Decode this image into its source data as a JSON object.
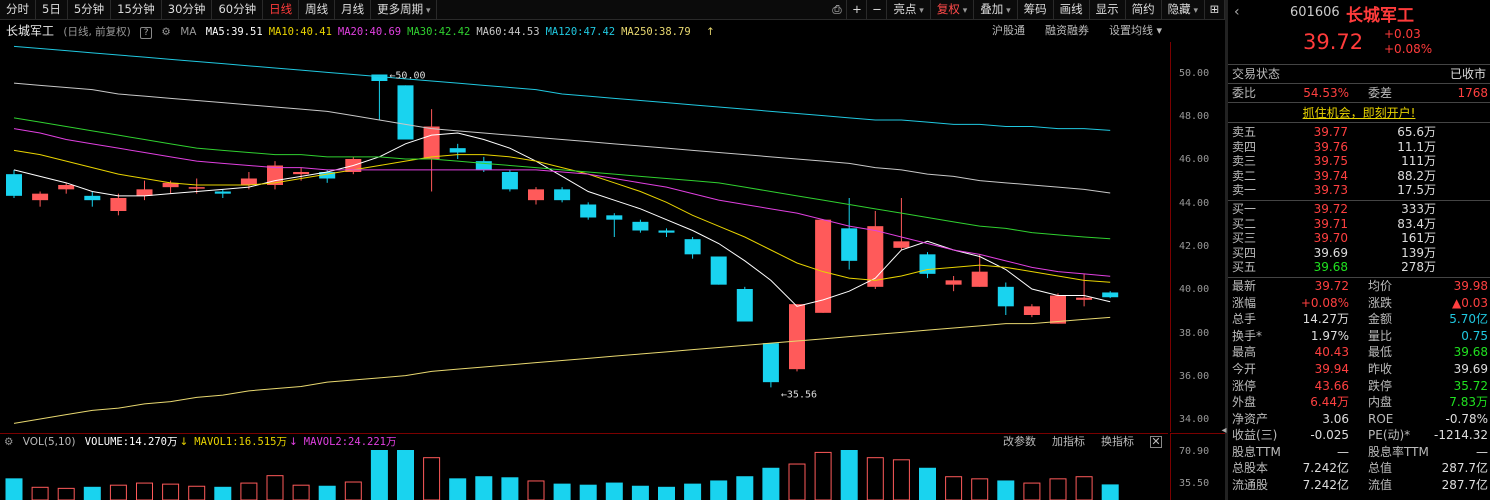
{
  "toolbar": {
    "left": [
      "分时",
      "5日",
      "5分钟",
      "15分钟",
      "30分钟",
      "60分钟",
      "日线",
      "周线",
      "月线",
      "更多周期"
    ],
    "active": "日线",
    "right": [
      "亮点",
      "复权",
      "叠加",
      "筹码",
      "画线",
      "显示",
      "简约",
      "隐藏"
    ]
  },
  "chart_header": {
    "name": "长城军工",
    "mode": "(日线, 前复权)",
    "help": "?",
    "ma_label": "MA",
    "ma": [
      {
        "text": "MA5:39.51",
        "color": "#ffffff"
      },
      {
        "text": "MA10:40.41",
        "color": "#e8d300"
      },
      {
        "text": "MA20:40.69",
        "color": "#e040e0"
      },
      {
        "text": "MA30:42.42",
        "color": "#30d030"
      },
      {
        "text": "MA60:44.53",
        "color": "#c8c8c8"
      },
      {
        "text": "MA120:47.42",
        "color": "#20c8e0"
      },
      {
        "text": "MA250:38.79",
        "color": "#e8d870"
      }
    ],
    "links": [
      "沪股通",
      "融资融券",
      "设置均线"
    ]
  },
  "price_axis": [
    "50.00",
    "48.00",
    "46.00",
    "44.00",
    "42.00",
    "40.00",
    "38.00",
    "36.00",
    "34.00"
  ],
  "annotations": {
    "high": "50.00",
    "low": "35.56"
  },
  "volume_header": {
    "title": "VOL(5,10)",
    "items": [
      {
        "text": "VOLUME:14.270万",
        "color": "#ffffff"
      },
      {
        "text": "MAVOL1:16.515万",
        "color": "#e8d300"
      },
      {
        "text": "MAVOL2:24.221万",
        "color": "#e040e0"
      }
    ],
    "links": [
      "改参数",
      "加指标",
      "换指标"
    ]
  },
  "volume_axis": [
    "70.90",
    "35.50"
  ],
  "panel": {
    "code": "601606",
    "name": "长城军工",
    "price": "39.72",
    "change": "+0.03",
    "change_pct": "+0.08%",
    "status_label": "交易状态",
    "status_value": "已收市",
    "ratio_label": "委比",
    "ratio_value": "54.53%",
    "diff_label": "委差",
    "diff_value": "1768",
    "banner": "抓住机会，即刻开户!",
    "sells": [
      {
        "label": "卖五",
        "price": "39.77",
        "vol": "65.6万"
      },
      {
        "label": "卖四",
        "price": "39.76",
        "vol": "11.1万"
      },
      {
        "label": "卖三",
        "price": "39.75",
        "vol": "111万"
      },
      {
        "label": "卖二",
        "price": "39.74",
        "vol": "88.2万"
      },
      {
        "label": "卖一",
        "price": "39.73",
        "vol": "17.5万"
      }
    ],
    "buys": [
      {
        "label": "买一",
        "price": "39.72",
        "vol": "333万",
        "color": "#ff4040"
      },
      {
        "label": "买二",
        "price": "39.71",
        "vol": "83.4万",
        "color": "#ff4040"
      },
      {
        "label": "买三",
        "price": "39.70",
        "vol": "161万",
        "color": "#ff4040"
      },
      {
        "label": "买四",
        "price": "39.69",
        "vol": "139万",
        "color": "#dddddd"
      },
      {
        "label": "买五",
        "price": "39.68",
        "vol": "278万",
        "color": "#20e020"
      }
    ],
    "quotes": [
      {
        "l1": "最新",
        "v1": "39.72",
        "c1": "#ff4040",
        "l2": "均价",
        "v2": "39.98",
        "c2": "#ff4040"
      },
      {
        "l1": "涨幅",
        "v1": "+0.08%",
        "c1": "#ff4040",
        "l2": "涨跌",
        "v2": "▲0.03",
        "c2": "#ff4040"
      },
      {
        "l1": "总手",
        "v1": "14.27万",
        "c1": "#dddddd",
        "l2": "金额",
        "v2": "5.70亿",
        "c2": "#20c8e0"
      },
      {
        "l1": "换手*",
        "v1": "1.97%",
        "c1": "#dddddd",
        "l2": "量比",
        "v2": "0.75",
        "c2": "#20c8e0"
      },
      {
        "l1": "最高",
        "v1": "40.43",
        "c1": "#ff4040",
        "l2": "最低",
        "v2": "39.68",
        "c2": "#20e020"
      },
      {
        "l1": "今开",
        "v1": "39.94",
        "c1": "#ff4040",
        "l2": "昨收",
        "v2": "39.69",
        "c2": "#dddddd"
      },
      {
        "l1": "涨停",
        "v1": "43.66",
        "c1": "#ff4040",
        "l2": "跌停",
        "v2": "35.72",
        "c2": "#20e020"
      },
      {
        "l1": "外盘",
        "v1": "6.44万",
        "c1": "#ff4040",
        "l2": "内盘",
        "v2": "7.83万",
        "c2": "#20e020"
      },
      {
        "l1": "净资产",
        "v1": "3.06",
        "c1": "#dddddd",
        "l2": "ROE",
        "v2": "-0.78%",
        "c2": "#dddddd"
      },
      {
        "l1": "收益(三)",
        "v1": "-0.025",
        "c1": "#dddddd",
        "l2": "PE(动)*",
        "v2": "-1214.32",
        "c2": "#dddddd"
      },
      {
        "l1": "股息TTM",
        "v1": "—",
        "c1": "#dddddd",
        "l2": "股息率TTM",
        "v2": "—",
        "c2": "#dddddd"
      },
      {
        "l1": "总股本",
        "v1": "7.242亿",
        "c1": "#dddddd",
        "l2": "总值",
        "v2": "287.7亿",
        "c2": "#dddddd"
      },
      {
        "l1": "流通股",
        "v1": "7.242亿",
        "c1": "#dddddd",
        "l2": "流值",
        "v2": "287.7亿",
        "c2": "#dddddd"
      }
    ]
  },
  "colors": {
    "up": "#ff5a5a",
    "down": "#19d3ef",
    "ma5": "#ffffff",
    "ma10": "#e8d300",
    "ma20": "#e040e0",
    "ma30": "#30d030",
    "ma60": "#c8c8c8",
    "ma120": "#20c8e0",
    "ma250": "#e8d870"
  },
  "chart_data": {
    "type": "candlestick",
    "ylim": [
      33.5,
      51.5
    ],
    "candles": [
      {
        "o": 45.4,
        "c": 44.4,
        "h": 45.6,
        "l": 44.3
      },
      {
        "o": 44.2,
        "c": 44.5,
        "h": 44.6,
        "l": 43.9
      },
      {
        "o": 44.7,
        "c": 44.9,
        "h": 45.0,
        "l": 44.5
      },
      {
        "o": 44.4,
        "c": 44.2,
        "h": 44.6,
        "l": 43.9
      },
      {
        "o": 43.7,
        "c": 44.3,
        "h": 44.5,
        "l": 43.5
      },
      {
        "o": 44.4,
        "c": 44.7,
        "h": 45.1,
        "l": 44.2
      },
      {
        "o": 44.8,
        "c": 45.0,
        "h": 45.1,
        "l": 44.5
      },
      {
        "o": 44.8,
        "c": 44.8,
        "h": 45.2,
        "l": 44.5
      },
      {
        "o": 44.6,
        "c": 44.5,
        "h": 44.7,
        "l": 44.3
      },
      {
        "o": 44.9,
        "c": 45.2,
        "h": 45.5,
        "l": 44.7
      },
      {
        "o": 44.9,
        "c": 45.8,
        "h": 46.0,
        "l": 44.7
      },
      {
        "o": 45.4,
        "c": 45.5,
        "h": 45.7,
        "l": 45.1
      },
      {
        "o": 45.5,
        "c": 45.2,
        "h": 45.6,
        "l": 45.0
      },
      {
        "o": 45.5,
        "c": 46.1,
        "h": 46.2,
        "l": 45.4
      },
      {
        "o": 50.0,
        "c": 49.7,
        "h": 50.0,
        "l": 47.9
      },
      {
        "o": 49.5,
        "c": 47.0,
        "h": 49.5,
        "l": 47.0
      },
      {
        "o": 46.1,
        "c": 47.6,
        "h": 48.4,
        "l": 44.6
      },
      {
        "o": 46.6,
        "c": 46.4,
        "h": 46.8,
        "l": 46.1
      },
      {
        "o": 46.0,
        "c": 45.6,
        "h": 46.2,
        "l": 45.5
      },
      {
        "o": 45.5,
        "c": 44.7,
        "h": 45.6,
        "l": 44.6
      },
      {
        "o": 44.2,
        "c": 44.7,
        "h": 44.8,
        "l": 44.0
      },
      {
        "o": 44.7,
        "c": 44.2,
        "h": 44.8,
        "l": 44.1
      },
      {
        "o": 44.0,
        "c": 43.4,
        "h": 44.1,
        "l": 43.3
      },
      {
        "o": 43.5,
        "c": 43.3,
        "h": 43.6,
        "l": 42.5
      },
      {
        "o": 43.2,
        "c": 42.8,
        "h": 43.3,
        "l": 42.7
      },
      {
        "o": 42.8,
        "c": 42.7,
        "h": 42.9,
        "l": 42.5
      },
      {
        "o": 42.4,
        "c": 41.7,
        "h": 42.5,
        "l": 41.5
      },
      {
        "o": 41.6,
        "c": 40.3,
        "h": 41.6,
        "l": 40.3
      },
      {
        "o": 40.1,
        "c": 38.6,
        "h": 40.2,
        "l": 38.6
      },
      {
        "o": 37.6,
        "c": 35.8,
        "h": 37.6,
        "l": 35.56
      },
      {
        "o": 36.4,
        "c": 39.4,
        "h": 39.4,
        "l": 36.3
      },
      {
        "o": 39.0,
        "c": 43.3,
        "h": 43.3,
        "l": 39.0
      },
      {
        "o": 42.9,
        "c": 41.4,
        "h": 44.3,
        "l": 41.0
      },
      {
        "o": 40.2,
        "c": 43.0,
        "h": 43.7,
        "l": 40.1
      },
      {
        "o": 42.0,
        "c": 42.3,
        "h": 44.3,
        "l": 41.9
      },
      {
        "o": 41.7,
        "c": 40.8,
        "h": 41.8,
        "l": 40.6
      },
      {
        "o": 40.3,
        "c": 40.5,
        "h": 40.7,
        "l": 40.0
      },
      {
        "o": 40.2,
        "c": 40.9,
        "h": 41.7,
        "l": 40.2
      },
      {
        "o": 40.2,
        "c": 39.3,
        "h": 40.4,
        "l": 38.9
      },
      {
        "o": 38.9,
        "c": 39.3,
        "h": 39.4,
        "l": 38.8
      },
      {
        "o": 38.5,
        "c": 39.8,
        "h": 39.9,
        "l": 38.5
      },
      {
        "o": 39.6,
        "c": 39.7,
        "h": 40.8,
        "l": 39.3
      },
      {
        "o": 39.94,
        "c": 39.72,
        "h": 40.0,
        "l": 39.68
      }
    ],
    "ma_lines": [
      {
        "name": "MA5",
        "color": "#ffffff",
        "values": [
          45.6,
          45.3,
          45.0,
          44.6,
          44.4,
          44.4,
          44.5,
          44.6,
          44.7,
          44.8,
          45.1,
          45.3,
          45.5,
          45.8,
          46.2,
          46.8,
          47.2,
          47.3,
          47.0,
          46.6,
          46.0,
          45.3,
          44.6,
          44.2,
          43.8,
          43.3,
          42.8,
          42.2,
          41.4,
          40.5,
          39.3,
          39.6,
          40.0,
          40.6,
          41.9,
          42.3,
          41.9,
          41.6,
          41.0,
          40.1,
          39.8,
          39.8,
          39.51
        ]
      },
      {
        "name": "MA10",
        "color": "#e8d300",
        "values": [
          46.5,
          46.3,
          46.0,
          45.7,
          45.4,
          45.2,
          45.0,
          44.9,
          44.9,
          44.9,
          45.0,
          45.2,
          45.4,
          45.6,
          45.8,
          46.0,
          46.2,
          46.3,
          46.3,
          46.2,
          46.0,
          45.7,
          45.4,
          45.0,
          44.6,
          44.1,
          43.5,
          43.0,
          42.5,
          41.9,
          41.3,
          40.9,
          40.6,
          40.5,
          40.7,
          41.0,
          41.1,
          41.2,
          41.1,
          40.9,
          40.7,
          40.5,
          40.41
        ]
      },
      {
        "name": "MA20",
        "color": "#e040e0",
        "values": [
          47.5,
          47.3,
          47.0,
          46.8,
          46.6,
          46.4,
          46.2,
          46.0,
          45.9,
          45.8,
          45.7,
          45.7,
          45.6,
          45.6,
          45.6,
          45.6,
          45.6,
          45.6,
          45.6,
          45.6,
          45.6,
          45.5,
          45.4,
          45.2,
          45.0,
          44.8,
          44.5,
          44.2,
          44.0,
          43.8,
          43.6,
          43.3,
          43.0,
          42.8,
          42.5,
          42.2,
          41.9,
          41.7,
          41.4,
          41.1,
          40.9,
          40.8,
          40.69
        ]
      },
      {
        "name": "MA30",
        "color": "#30d030",
        "values": [
          48.0,
          47.8,
          47.6,
          47.4,
          47.2,
          47.0,
          46.8,
          46.6,
          46.5,
          46.4,
          46.3,
          46.3,
          46.2,
          46.2,
          46.2,
          46.1,
          46.1,
          46.0,
          45.9,
          45.8,
          45.7,
          45.6,
          45.5,
          45.4,
          45.3,
          45.2,
          45.1,
          45.0,
          44.8,
          44.6,
          44.4,
          44.2,
          44.0,
          43.8,
          43.6,
          43.4,
          43.2,
          43.0,
          42.9,
          42.7,
          42.6,
          42.5,
          42.42
        ]
      },
      {
        "name": "MA60",
        "color": "#c8c8c8",
        "values": [
          49.6,
          49.5,
          49.4,
          49.3,
          49.1,
          49.0,
          48.9,
          48.8,
          48.7,
          48.6,
          48.5,
          48.4,
          48.3,
          48.1,
          47.9,
          47.7,
          47.5,
          47.4,
          47.3,
          47.2,
          47.1,
          47.0,
          46.9,
          46.8,
          46.7,
          46.6,
          46.5,
          46.4,
          46.3,
          46.2,
          46.1,
          46.0,
          45.9,
          45.7,
          45.6,
          45.4,
          45.3,
          45.1,
          45.0,
          44.9,
          44.8,
          44.7,
          44.53
        ]
      },
      {
        "name": "MA120",
        "color": "#20c8e0",
        "values": [
          51.3,
          51.2,
          51.1,
          51.0,
          50.9,
          50.8,
          50.7,
          50.6,
          50.5,
          50.4,
          50.3,
          50.2,
          50.1,
          50.0,
          49.9,
          49.8,
          49.7,
          49.6,
          49.5,
          49.4,
          49.3,
          49.1,
          49.0,
          48.9,
          48.8,
          48.7,
          48.6,
          48.5,
          48.4,
          48.3,
          48.2,
          48.1,
          48.0,
          47.9,
          47.9,
          47.8,
          47.7,
          47.7,
          47.6,
          47.6,
          47.5,
          47.5,
          47.42
        ]
      },
      {
        "name": "MA250",
        "color": "#e8d870",
        "values": [
          33.9,
          34.1,
          34.3,
          34.5,
          34.6,
          34.8,
          34.9,
          35.1,
          35.2,
          35.4,
          35.5,
          35.6,
          35.8,
          35.9,
          36.0,
          36.1,
          36.3,
          36.4,
          36.5,
          36.6,
          36.7,
          36.8,
          36.9,
          37.0,
          37.1,
          37.2,
          37.3,
          37.4,
          37.5,
          37.6,
          37.7,
          37.8,
          37.9,
          38.0,
          38.1,
          38.2,
          38.3,
          38.4,
          38.5,
          38.5,
          38.6,
          38.7,
          38.79
        ]
      }
    ],
    "volumes": [
      20,
      12,
      11,
      12,
      14,
      16,
      15,
      13,
      12,
      16,
      23,
      14,
      13,
      17,
      65,
      55,
      40,
      20,
      22,
      21,
      18,
      15,
      14,
      16,
      13,
      12,
      15,
      18,
      22,
      30,
      34,
      45,
      58,
      40,
      38,
      30,
      22,
      20,
      18,
      16,
      20,
      22,
      14.27
    ]
  }
}
